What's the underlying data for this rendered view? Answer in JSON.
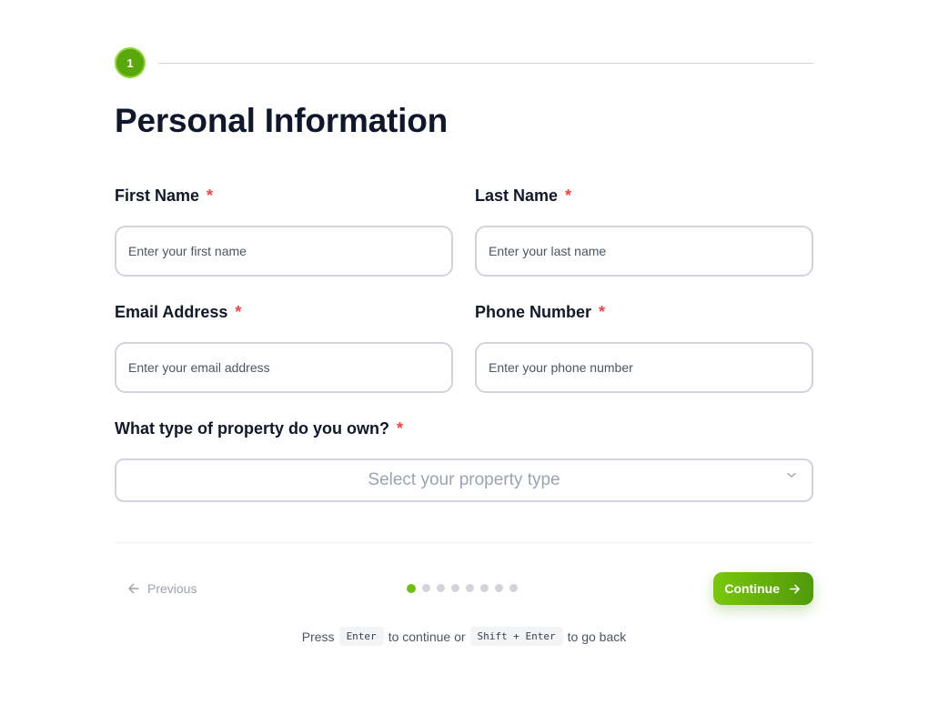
{
  "step": {
    "number": "1"
  },
  "page_title": "Personal Information",
  "fields": {
    "first_name": {
      "label": "First Name",
      "required": "*",
      "placeholder": "Enter your first name",
      "value": ""
    },
    "last_name": {
      "label": "Last Name",
      "required": "*",
      "placeholder": "Enter your last name",
      "value": ""
    },
    "email": {
      "label": "Email Address",
      "required": "*",
      "placeholder": "Enter your email address",
      "value": ""
    },
    "phone": {
      "label": "Phone Number",
      "required": "*",
      "placeholder": "Enter your phone number",
      "value": ""
    },
    "property_type": {
      "label": "What type of property do you own?",
      "required": "*",
      "placeholder": "Select your property type"
    }
  },
  "navigation": {
    "previous_label": "Previous",
    "continue_label": "Continue",
    "progress": {
      "current": 1,
      "total": 8
    }
  },
  "hint": {
    "press": "Press",
    "enter_key": "Enter",
    "middle": "to continue or",
    "back_key": "Shift + Enter",
    "end": "to go back"
  },
  "colors": {
    "accent": "#6cc00f",
    "accent_dark": "#4f9a0a",
    "required": "#ef4444",
    "border": "#d1d5db"
  },
  "icons": {
    "previous": "arrow-left-icon",
    "continue": "arrow-right-icon",
    "select": "chevron-down-icon"
  }
}
